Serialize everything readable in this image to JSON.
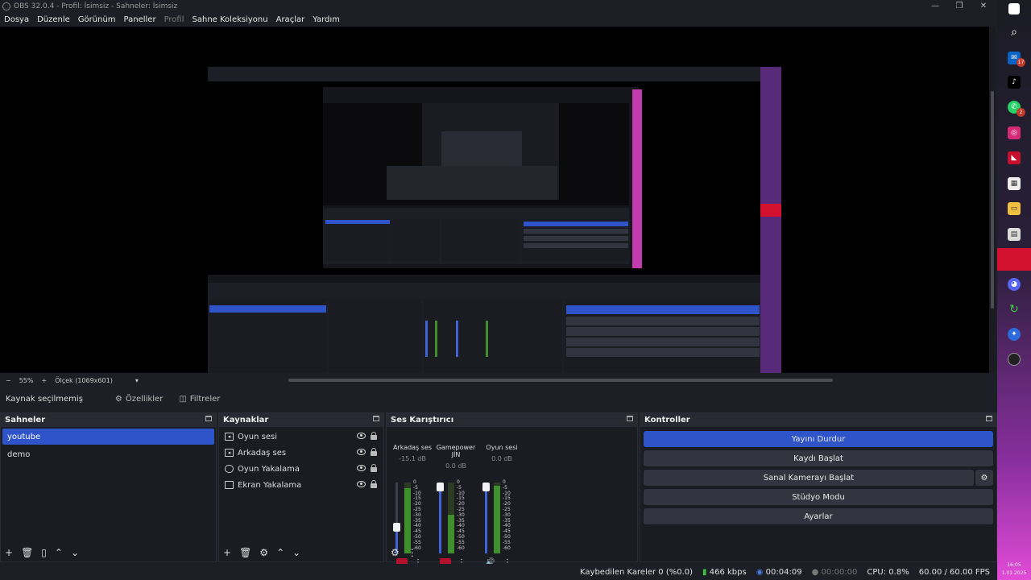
{
  "window": {
    "title": "OBS 32.0.4 - Profil: İsimsiz - Sahneler: İsimsiz",
    "minimize": "—",
    "restore": "❐",
    "close": "✕"
  },
  "menu": {
    "items": [
      {
        "label": "Dosya"
      },
      {
        "label": "Düzenle"
      },
      {
        "label": "Görünüm"
      },
      {
        "label": "Paneller"
      },
      {
        "label": "Profil"
      },
      {
        "label": "Sahne Koleksiyonu"
      },
      {
        "label": "Araçlar"
      },
      {
        "label": "Yardım"
      }
    ]
  },
  "zoom": {
    "minus": "−",
    "value": "55%",
    "plus": "+",
    "scale_label": "Ölçek (1069x601)",
    "dropdown": "▾"
  },
  "source_toolbar": {
    "no_source": "Kaynak seçilmemiş",
    "properties": "Özellikler",
    "filters": "Filtreler"
  },
  "scenes": {
    "title": "Sahneler",
    "items": [
      {
        "label": "youtube",
        "selected": true
      },
      {
        "label": "demo",
        "selected": false
      }
    ],
    "footer": [
      "+",
      "🗑",
      "▯",
      "⌃",
      "⌄"
    ]
  },
  "sources": {
    "title": "Kaynaklar",
    "items": [
      {
        "label": "Oyun sesi",
        "icon": "audio-output-icon"
      },
      {
        "label": "Arkadaş ses",
        "icon": "audio-output-icon"
      },
      {
        "label": "Oyun Yakalama",
        "icon": "gamepad-icon"
      },
      {
        "label": "Ekran Yakalama",
        "icon": "monitor-icon"
      }
    ],
    "footer": [
      "+",
      "🗑",
      "⚙",
      "⌃",
      "⌄"
    ]
  },
  "mixer": {
    "title": "Ses Karıştırıcı",
    "channels": [
      {
        "name": "Arkadaş ses",
        "db": "-15.1 dB",
        "volume_fraction": 0.38,
        "level_fraction": 0.92,
        "muted": true
      },
      {
        "name": "Gamepower JİN",
        "db": "0.0 dB",
        "volume_fraction": 1.0,
        "level_fraction": 0.55,
        "muted": true
      },
      {
        "name": "Oyun sesi",
        "db": "0.0 dB",
        "volume_fraction": 1.0,
        "level_fraction": 0.95,
        "muted": false
      }
    ],
    "ticks": [
      "0",
      "-5",
      "-10",
      "-15",
      "-20",
      "-25",
      "-30",
      "-35",
      "-40",
      "-45",
      "-50",
      "-55",
      "-60"
    ],
    "menu_glyph": "⋮"
  },
  "controls": {
    "title": "Kontroller",
    "stop_stream": "Yayını Durdur",
    "start_record": "Kaydı Başlat",
    "start_virtual_cam": "Sanal Kamerayı Başlat",
    "studio_mode": "Stüdyo Modu",
    "settings": "Ayarlar"
  },
  "status": {
    "dropped_frames": "Kaybedilen Kareler 0 (%0.0)",
    "bitrate": "466 kbps",
    "stream_time": "00:04:09",
    "record_time": "00:00:00",
    "cpu": "CPU: 0.8%",
    "fps": "60.00 / 60.00 FPS"
  },
  "taskbar": {
    "badge_mail": "17",
    "badge_whatsapp": "2",
    "clock_time": "16:05",
    "clock_date": "1.01.2025"
  },
  "colors": {
    "accent": "#2f54c9",
    "panel": "#24262e",
    "background": "#1d1f26",
    "mute_red": "#b3112e"
  }
}
